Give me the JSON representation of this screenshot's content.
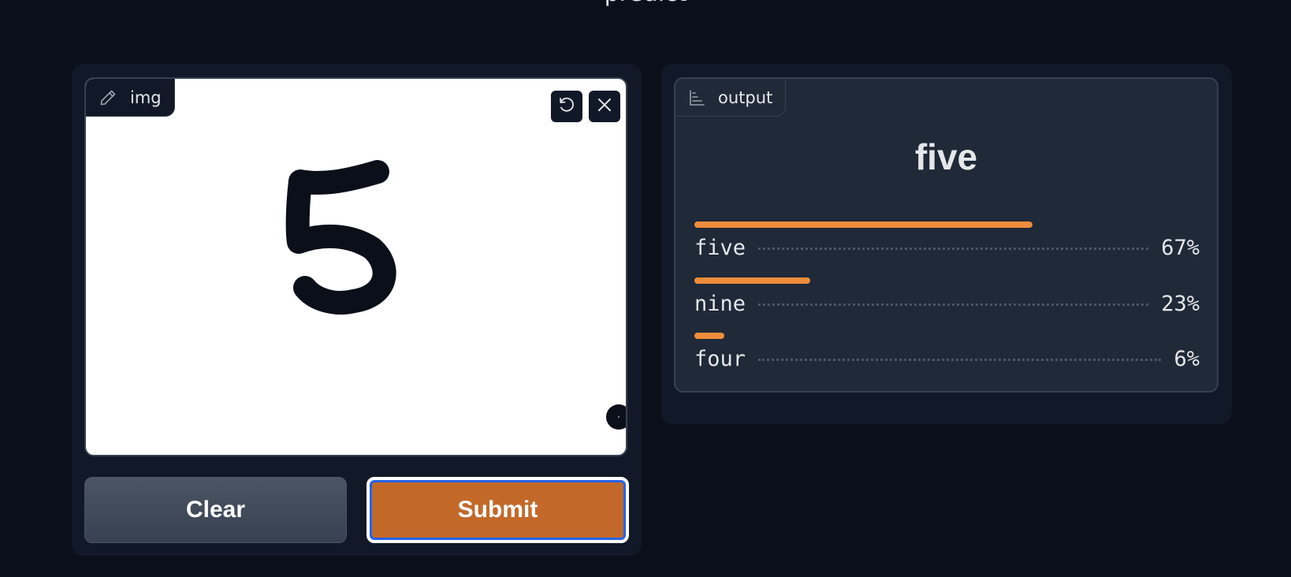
{
  "page": {
    "title": "predict"
  },
  "input": {
    "label": "img",
    "undo_icon": "undo-icon",
    "close_icon": "close-icon"
  },
  "buttons": {
    "clear": "Clear",
    "submit": "Submit"
  },
  "output": {
    "label": "output",
    "prediction": "five",
    "confidences": [
      {
        "label": "five",
        "value": 0.67,
        "percent": "67%"
      },
      {
        "label": "nine",
        "value": 0.23,
        "percent": "23%"
      },
      {
        "label": "four",
        "value": 0.06,
        "percent": "6%"
      }
    ]
  },
  "colors": {
    "background": "#0b0f19",
    "panel": "#111827",
    "accent": "#c2692a",
    "bar": "#ef8c3b"
  }
}
